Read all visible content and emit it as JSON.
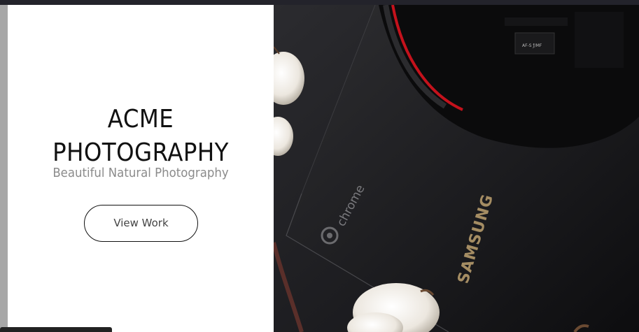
{
  "hero": {
    "title_line1": "ACME",
    "title_line2": "PHOTOGRAPHY",
    "subtitle": "Beautiful Natural Photography",
    "cta_label": "View Work"
  },
  "photo": {
    "laptop_brand": "SAMSUNG",
    "laptop_os": "chrome",
    "lens_marking": "AF-S ƒ/MF"
  },
  "colors": {
    "panel_bg": "#ffffff",
    "title": "#111111",
    "subtitle": "#8b8b8b",
    "photo_bg": "#1a1a1f",
    "lens_accent": "#c4121c"
  }
}
